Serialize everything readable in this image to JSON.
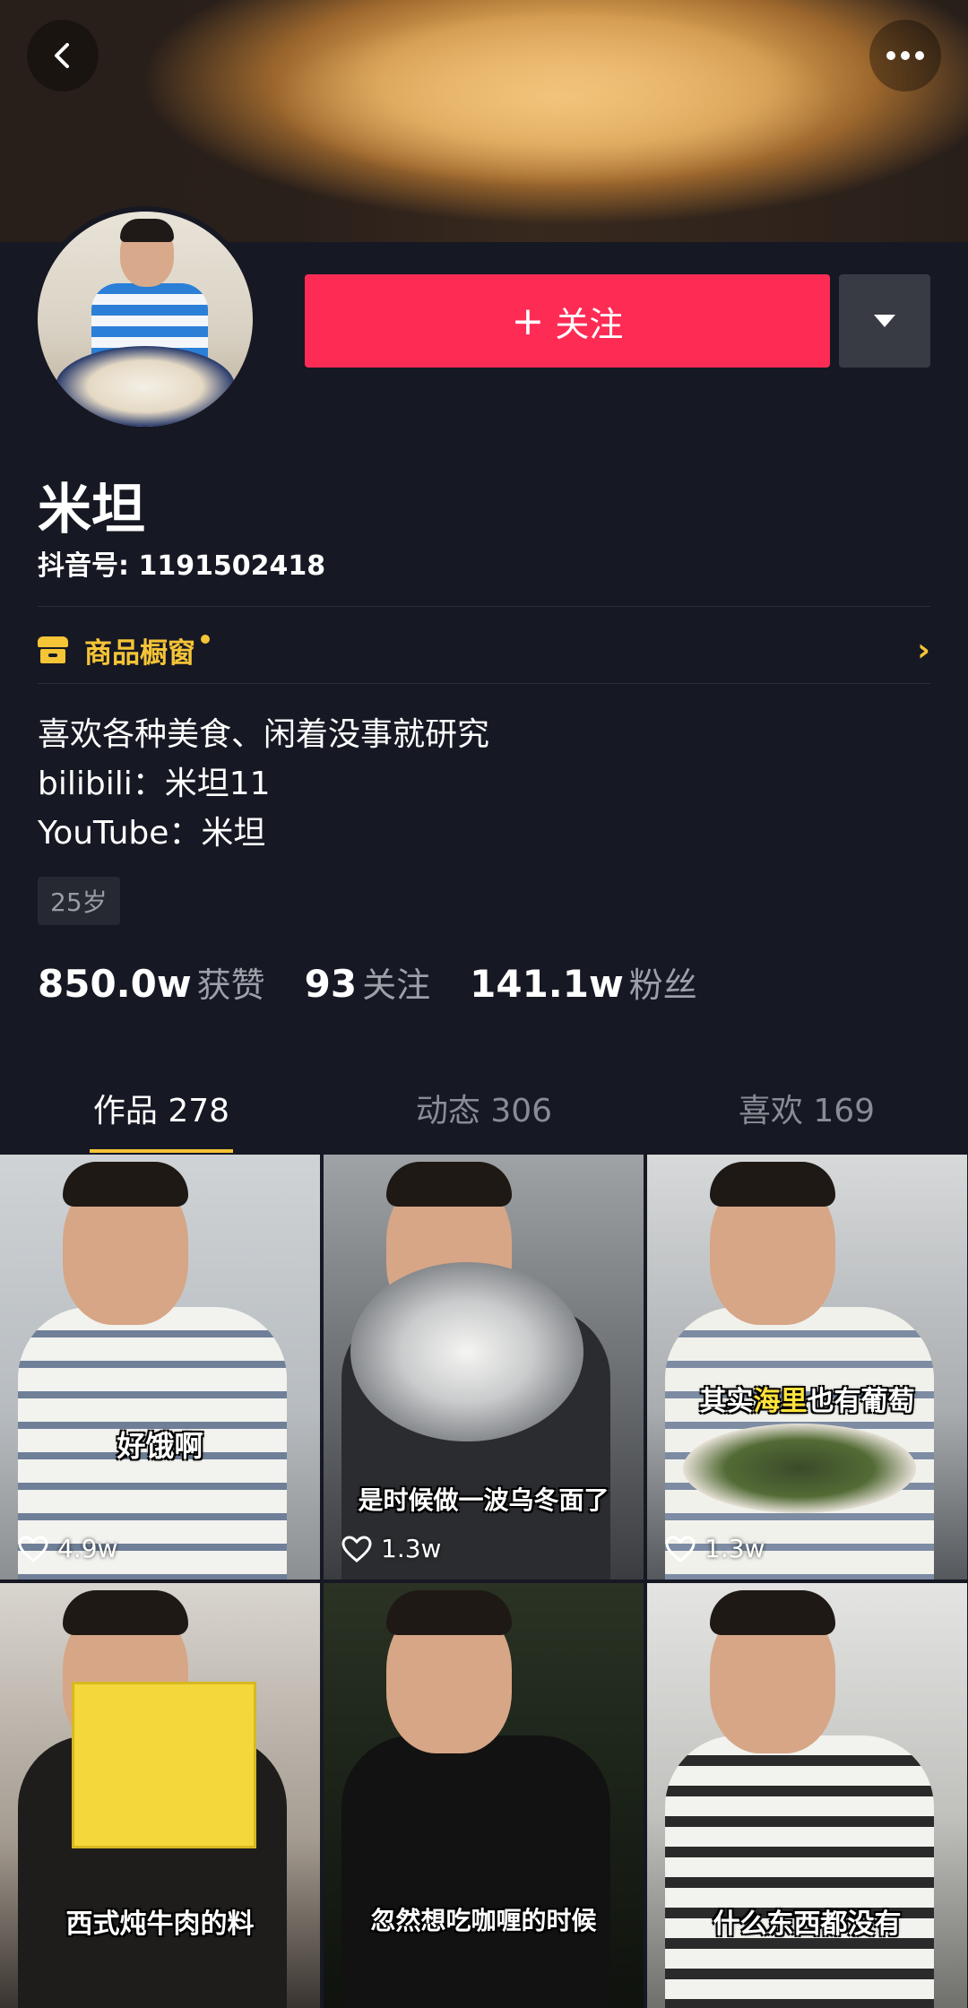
{
  "header": {
    "back_icon": "chevron-left-icon",
    "more_icon": "more-horizontal-icon"
  },
  "actions": {
    "follow_plus": "+",
    "follow_label": "关注",
    "dropdown_icon": "triangle-down-icon"
  },
  "profile": {
    "name": "米坦",
    "douyin_id": "抖音号: 1191502418",
    "shop_label": "商品橱窗",
    "shop_chevron": "›",
    "bio": [
      "喜欢各种美食、闲着没事就研究",
      "bilibili：米坦11",
      "YouTube：米坦"
    ],
    "age_tag": "25岁"
  },
  "stats": [
    {
      "num": "850.0w",
      "label": "获赞"
    },
    {
      "num": "93",
      "label": "关注"
    },
    {
      "num": "141.1w",
      "label": "粉丝"
    }
  ],
  "tabs": [
    {
      "label": "作品 278",
      "active": true
    },
    {
      "label": "动态 306",
      "active": false
    },
    {
      "label": "喜欢 169",
      "active": false
    }
  ],
  "videos": [
    {
      "caption": "好饿啊",
      "likes": "4.9w"
    },
    {
      "caption": "是时候做一波乌冬面了",
      "likes": "1.3w"
    },
    {
      "caption_pre": "其实",
      "caption_hl": "海里",
      "caption_post": "也有葡萄",
      "likes": "1.3w"
    },
    {
      "caption": "西式炖牛肉的料",
      "likes": ""
    },
    {
      "caption": "忽然想吃咖喱的时候",
      "likes": ""
    },
    {
      "caption": "什么东西都没有",
      "likes": ""
    }
  ],
  "colors": {
    "accent": "#fe2c55",
    "shop": "#f5c437",
    "background": "#161823"
  }
}
